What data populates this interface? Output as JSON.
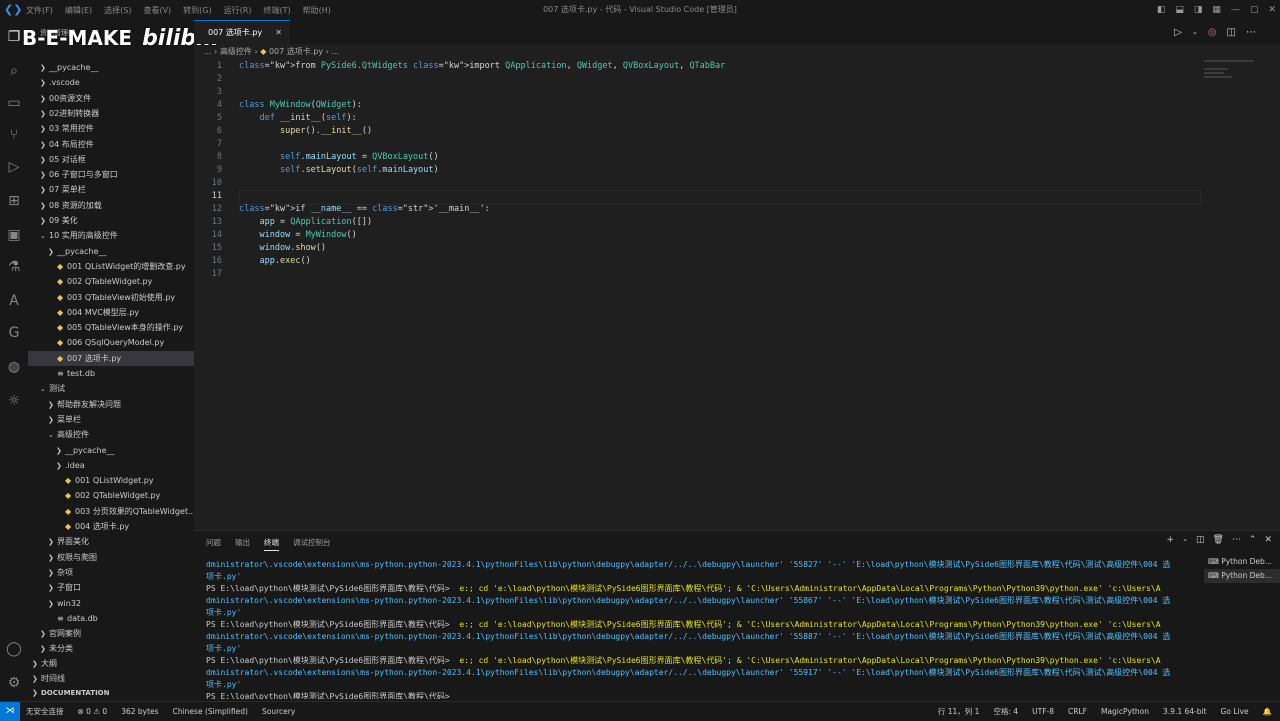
{
  "window": {
    "title": "007 选项卡.py - 代码 - Visual Studio Code [管理员]",
    "menu": [
      "文件(F)",
      "编辑(E)",
      "选择(S)",
      "查看(V)",
      "转到(G)",
      "运行(R)",
      "终端(T)",
      "帮助(H)"
    ]
  },
  "watermark": {
    "text": "B-E-MAKE",
    "bili": "bilibili"
  },
  "sidebar": {
    "header": "资源管理器",
    "items": [
      {
        "label": "__pycache__",
        "kind": "dir",
        "open": false,
        "depth": 1
      },
      {
        "label": ".vscode",
        "kind": "dir",
        "open": false,
        "depth": 1
      },
      {
        "label": "00资源文件",
        "kind": "dir",
        "open": false,
        "depth": 1
      },
      {
        "label": "02进制转换器",
        "kind": "dir",
        "open": false,
        "depth": 1
      },
      {
        "label": "03 常用控件",
        "kind": "dir",
        "open": false,
        "depth": 1
      },
      {
        "label": "04 布局控件",
        "kind": "dir",
        "open": false,
        "depth": 1
      },
      {
        "label": "05 对话框",
        "kind": "dir",
        "open": false,
        "depth": 1
      },
      {
        "label": "06 子窗口与多窗口",
        "kind": "dir",
        "open": false,
        "depth": 1
      },
      {
        "label": "07 菜单栏",
        "kind": "dir",
        "open": false,
        "depth": 1
      },
      {
        "label": "08 资源的加载",
        "kind": "dir",
        "open": false,
        "depth": 1
      },
      {
        "label": "09 美化",
        "kind": "dir",
        "open": false,
        "depth": 1
      },
      {
        "label": "10 实用的高级控件",
        "kind": "dir",
        "open": true,
        "depth": 1
      },
      {
        "label": "__pycache__",
        "kind": "dir",
        "open": false,
        "depth": 2
      },
      {
        "label": "001 QListWidget的增删改查.py",
        "kind": "py",
        "depth": 2
      },
      {
        "label": "002 QTableWidget.py",
        "kind": "py",
        "depth": 2
      },
      {
        "label": "003 QTableView初始使用.py",
        "kind": "py",
        "depth": 2
      },
      {
        "label": "004 MVC模型层.py",
        "kind": "py",
        "depth": 2
      },
      {
        "label": "005 QTableView本身的操作.py",
        "kind": "py",
        "depth": 2
      },
      {
        "label": "006 QSqlQueryModel.py",
        "kind": "py",
        "depth": 2
      },
      {
        "label": "007 选项卡.py",
        "kind": "py",
        "depth": 2,
        "selected": true
      },
      {
        "label": "test.db",
        "kind": "db",
        "depth": 2
      },
      {
        "label": "测试",
        "kind": "dir",
        "open": true,
        "depth": 1
      },
      {
        "label": "帮助群友解决问题",
        "kind": "dir",
        "open": false,
        "depth": 2
      },
      {
        "label": "菜单栏",
        "kind": "dir",
        "open": false,
        "depth": 2
      },
      {
        "label": "高级控件",
        "kind": "dir",
        "open": true,
        "depth": 2
      },
      {
        "label": "__pycache__",
        "kind": "dir",
        "open": false,
        "depth": 3
      },
      {
        "label": ".idea",
        "kind": "dir",
        "open": false,
        "depth": 3
      },
      {
        "label": "001 QListWidget.py",
        "kind": "py",
        "depth": 3
      },
      {
        "label": "002 QTableWidget.py",
        "kind": "py",
        "depth": 3
      },
      {
        "label": "003 分页效果的QTableWidget...",
        "kind": "py",
        "depth": 3
      },
      {
        "label": "004 选项卡.py",
        "kind": "py",
        "depth": 3
      },
      {
        "label": "界面美化",
        "kind": "dir",
        "open": false,
        "depth": 2
      },
      {
        "label": "权限与爬图",
        "kind": "dir",
        "open": false,
        "depth": 2
      },
      {
        "label": "杂项",
        "kind": "dir",
        "open": false,
        "depth": 2
      },
      {
        "label": "子窗口",
        "kind": "dir",
        "open": false,
        "depth": 2
      },
      {
        "label": "win32",
        "kind": "dir",
        "open": false,
        "depth": 2
      },
      {
        "label": "data.db",
        "kind": "db",
        "depth": 2
      },
      {
        "label": "官网案例",
        "kind": "dir",
        "open": false,
        "depth": 1
      },
      {
        "label": "未分类",
        "kind": "dir",
        "open": false,
        "depth": 1
      }
    ],
    "sections": [
      "大纲",
      "时间线",
      "DOCUMENTATION"
    ]
  },
  "editor": {
    "tab": "007 选项卡.py",
    "breadcrumb": [
      "...",
      "高级控件",
      "007 选项卡.py",
      "..."
    ],
    "current_line": 11,
    "lines": [
      "from PySide6.QtWidgets import QApplication, QWidget, QVBoxLayout, QTabBar",
      "",
      "",
      "class MyWindow(QWidget):",
      "    def __init__(self):",
      "        super().__init__()",
      "",
      "        self.mainLayout = QVBoxLayout()",
      "        self.setLayout(self.mainLayout)",
      "",
      "",
      "if __name__ == '__main__':",
      "    app = QApplication([])",
      "    window = MyWindow()",
      "    window.show()",
      "    app.exec()",
      ""
    ]
  },
  "panel": {
    "tabs": [
      "问题",
      "输出",
      "终端",
      "调试控制台"
    ],
    "active_tab": "终端",
    "terminal_lines": [
      "dministrator\\.vscode\\extensions\\ms-python.python-2023.4.1\\pythonFiles\\lib\\python\\debugpy\\adapter/../..\\debugpy\\launcher' '55827' '--' 'E:\\load\\python\\模块测试\\PySide6图形界面库\\教程\\代码\\测试\\高级控件\\004 选",
      "项卡.py'",
      "PS E:\\load\\python\\模块测试\\PySide6图形界面库\\教程\\代码>  e:; cd 'e:\\load\\python\\模块测试\\PySide6图形界面库\\教程\\代码'; & 'C:\\Users\\Administrator\\AppData\\Local\\Programs\\Python\\Python39\\python.exe' 'c:\\Users\\A",
      "dministrator\\.vscode\\extensions\\ms-python.python-2023.4.1\\pythonFiles\\lib\\python\\debugpy\\adapter/../..\\debugpy\\launcher' '55867' '--' 'E:\\load\\python\\模块测试\\PySide6图形界面库\\教程\\代码\\测试\\高级控件\\004 选",
      "项卡.py'",
      "PS E:\\load\\python\\模块测试\\PySide6图形界面库\\教程\\代码>  e:; cd 'e:\\load\\python\\模块测试\\PySide6图形界面库\\教程\\代码'; & 'C:\\Users\\Administrator\\AppData\\Local\\Programs\\Python\\Python39\\python.exe' 'c:\\Users\\A",
      "dministrator\\.vscode\\extensions\\ms-python.python-2023.4.1\\pythonFiles\\lib\\python\\debugpy\\adapter/../..\\debugpy\\launcher' '55887' '--' 'E:\\load\\python\\模块测试\\PySide6图形界面库\\教程\\代码\\测试\\高级控件\\004 选",
      "项卡.py'",
      "PS E:\\load\\python\\模块测试\\PySide6图形界面库\\教程\\代码>  e:; cd 'e:\\load\\python\\模块测试\\PySide6图形界面库\\教程\\代码'; & 'C:\\Users\\Administrator\\AppData\\Local\\Programs\\Python\\Python39\\python.exe' 'c:\\Users\\A",
      "dministrator\\.vscode\\extensions\\ms-python.python-2023.4.1\\pythonFiles\\lib\\python\\debugpy\\adapter/../..\\debugpy\\launcher' '55917' '--' 'E:\\load\\python\\模块测试\\PySide6图形界面库\\教程\\代码\\测试\\高级控件\\004 选",
      "项卡.py'",
      "PS E:\\load\\python\\模块测试\\PySide6图形界面库\\教程\\代码>"
    ],
    "terminals": [
      "Python Deb...",
      "Python Deb..."
    ]
  },
  "status": {
    "left": [
      "无安全连接",
      "⊗ 0 ⚠ 0",
      "362 bytes",
      "Chinese (Simplified)",
      "Sourcery"
    ],
    "right": [
      "行 11，列 1",
      "空格: 4",
      "UTF-8",
      "CRLF",
      "MagicPython",
      "3.9.1 64-bit",
      "Go Live"
    ]
  }
}
